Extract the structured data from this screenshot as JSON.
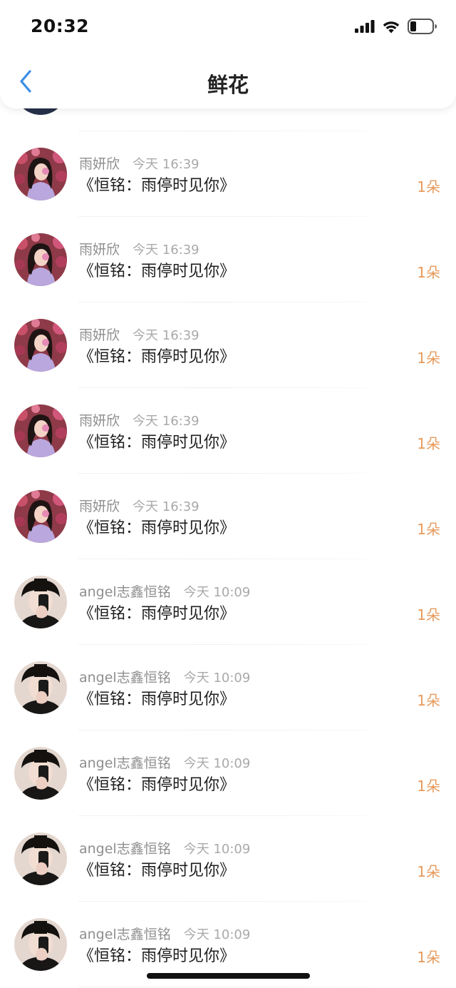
{
  "status_bar": {
    "time": "20:32",
    "icons": [
      "signal-icon",
      "wifi-icon",
      "battery-icon"
    ]
  },
  "nav": {
    "title": "鲜花",
    "back_icon": "chevron-left-icon"
  },
  "colors": {
    "accent_blue": "#3a8ee6",
    "count_orange": "#e79a5c",
    "meta_gray": "#8e8e8e"
  },
  "records": [
    {
      "sender": "",
      "time": "",
      "title": "",
      "count": "",
      "avatar": "dark-partial"
    },
    {
      "sender": "雨妍欣",
      "time": "今天 16:39",
      "title": "《恒铭：雨停时见你》",
      "count": "1朵",
      "avatar": "girl"
    },
    {
      "sender": "雨妍欣",
      "time": "今天 16:39",
      "title": "《恒铭：雨停时见你》",
      "count": "1朵",
      "avatar": "girl"
    },
    {
      "sender": "雨妍欣",
      "time": "今天 16:39",
      "title": "《恒铭：雨停时见你》",
      "count": "1朵",
      "avatar": "girl"
    },
    {
      "sender": "雨妍欣",
      "time": "今天 16:39",
      "title": "《恒铭：雨停时见你》",
      "count": "1朵",
      "avatar": "girl"
    },
    {
      "sender": "雨妍欣",
      "time": "今天 16:39",
      "title": "《恒铭：雨停时见你》",
      "count": "1朵",
      "avatar": "girl"
    },
    {
      "sender": "angel志鑫恒铭",
      "time": "今天 10:09",
      "title": "《恒铭：雨停时见你》",
      "count": "1朵",
      "avatar": "boy"
    },
    {
      "sender": "angel志鑫恒铭",
      "time": "今天 10:09",
      "title": "《恒铭：雨停时见你》",
      "count": "1朵",
      "avatar": "boy"
    },
    {
      "sender": "angel志鑫恒铭",
      "time": "今天 10:09",
      "title": "《恒铭：雨停时见你》",
      "count": "1朵",
      "avatar": "boy"
    },
    {
      "sender": "angel志鑫恒铭",
      "time": "今天 10:09",
      "title": "《恒铭：雨停时见你》",
      "count": "1朵",
      "avatar": "boy"
    },
    {
      "sender": "angel志鑫恒铭",
      "time": "今天 10:09",
      "title": "《恒铭：雨停时见你》",
      "count": "1朵",
      "avatar": "boy"
    }
  ]
}
